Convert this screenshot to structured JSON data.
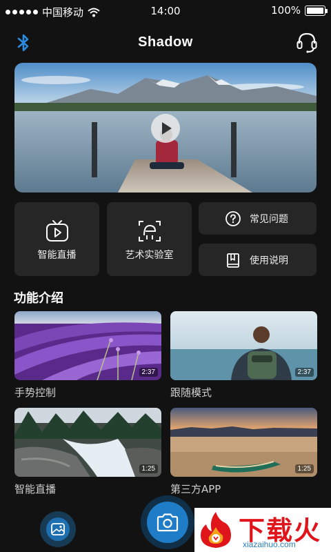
{
  "status_bar": {
    "carrier": "中国移动",
    "time": "14:00",
    "battery_text": "100%",
    "battery_level": 1.0,
    "signal_icon": "signal-dots-icon",
    "wifi_icon": "wifi-icon"
  },
  "header": {
    "title": "Shadow",
    "left_icon": "bluetooth-icon",
    "right_icon": "headset-icon"
  },
  "hero": {
    "play_icon": "play-icon"
  },
  "quick_tiles": [
    {
      "label": "智能直播",
      "icon": "tv-play-icon"
    },
    {
      "label": "艺术实验室",
      "icon": "face-scan-icon"
    }
  ],
  "quick_links": [
    {
      "label": "常见问题",
      "icon": "question-circle-icon"
    },
    {
      "label": "使用说明",
      "icon": "manual-book-icon"
    }
  ],
  "features": {
    "title": "功能介绍",
    "items": [
      {
        "label": "手势控制",
        "duration": "2:37"
      },
      {
        "label": "跟随模式",
        "duration": "2:37"
      },
      {
        "label": "智能直播",
        "duration": "1:25"
      },
      {
        "label": "第三方APP",
        "duration": "1:25"
      }
    ]
  },
  "bottom": {
    "gallery_icon": "gallery-icon",
    "camera_icon": "camera-icon"
  },
  "watermark": {
    "text": "下载火",
    "url": "xiazaihuo.com"
  },
  "colors": {
    "background": "#121212",
    "tile": "#262626",
    "accent": "#1f7cc6",
    "watermark_red": "#e0151b"
  }
}
